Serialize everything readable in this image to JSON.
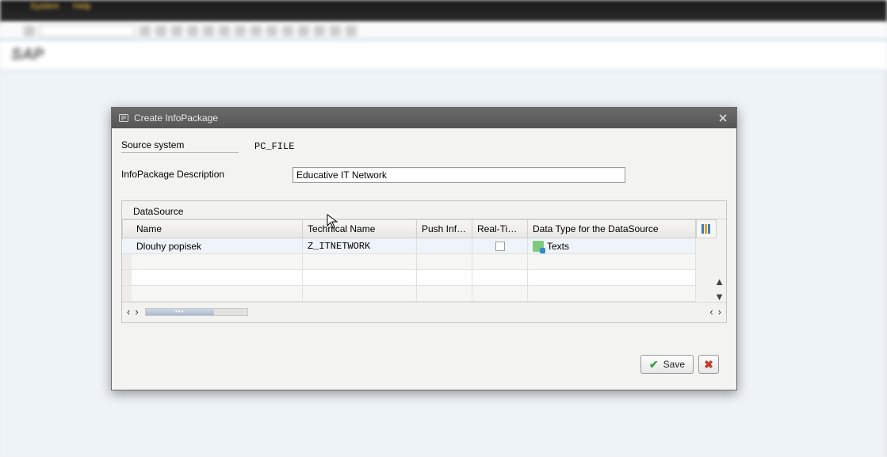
{
  "menu": {
    "system": "System",
    "help": "Help"
  },
  "banner": {
    "sap": "SAP"
  },
  "dialog": {
    "title": "Create InfoPackage",
    "source_system_label": "Source system",
    "source_system_value": "PC_FILE",
    "description_label": "InfoPackage Description",
    "description_value": "Educative IT Network",
    "save_label": "Save"
  },
  "datasource": {
    "section_label": "DataSource",
    "columns": {
      "name": "Name",
      "tech": "Technical Name",
      "push": "Push Info...",
      "rt": "Real-Time ...",
      "datatype": "Data Type for the DataSource"
    },
    "rows": [
      {
        "name": "Dlouhy popisek",
        "tech": "Z_ITNETWORK",
        "push": "",
        "rt_checked": false,
        "datatype": "Texts"
      }
    ]
  }
}
